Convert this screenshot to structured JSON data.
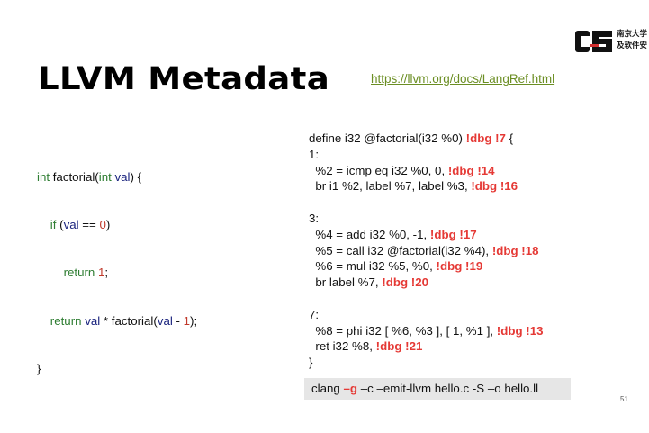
{
  "logo": {
    "mark": "CS",
    "line1": "南京大学",
    "line2": "及软件安",
    "colors": {
      "mark": "#111111",
      "accent": "#d32f2f"
    }
  },
  "slide": {
    "title": "LLVM Metadata",
    "ref_link": "https://llvm.org/docs/LangRef.html",
    "page_number": "51"
  },
  "c_code": {
    "line1": {
      "kw": "int",
      "fn": " factorial(",
      "kw2": "int",
      "var": " val",
      "rest": ") {"
    },
    "line2": {
      "indent": "    ",
      "kw": "if",
      "a": " (",
      "var": "val",
      "b": " == ",
      "num": "0",
      "c": ")"
    },
    "line3": {
      "indent": "        ",
      "kw": "return",
      "a": " ",
      "num": "1",
      "b": ";"
    },
    "line4": {
      "indent": "    ",
      "kw": "return",
      "var": " val",
      "a": " * factorial(",
      "var2": "val",
      "b": " - ",
      "num": "1",
      "c": ");"
    },
    "line5": {
      "text": "}"
    }
  },
  "ir": [
    {
      "text": "define i32 @factorial(i32 %0) ",
      "dbg": "!dbg !7",
      "tail": " {"
    },
    {
      "text": "1:",
      "dbg": "",
      "tail": ""
    },
    {
      "text": "  %2 = icmp eq i32 %0, 0, ",
      "dbg": "!dbg !14",
      "tail": ""
    },
    {
      "text": "  br i1 %2, label %7, label %3, ",
      "dbg": "!dbg !16",
      "tail": ""
    },
    {
      "text": "",
      "dbg": "",
      "tail": ""
    },
    {
      "text": "3:",
      "dbg": "",
      "tail": ""
    },
    {
      "text": "  %4 = add i32 %0, -1, ",
      "dbg": "!dbg !17",
      "tail": ""
    },
    {
      "text": "  %5 = call i32 @factorial(i32 %4), ",
      "dbg": "!dbg !18",
      "tail": ""
    },
    {
      "text": "  %6 = mul i32 %5, %0, ",
      "dbg": "!dbg !19",
      "tail": ""
    },
    {
      "text": "  br label %7, ",
      "dbg": "!dbg !20",
      "tail": ""
    },
    {
      "text": "",
      "dbg": "",
      "tail": ""
    },
    {
      "text": "7:",
      "dbg": "",
      "tail": ""
    },
    {
      "text": "  %8 = phi i32 [ %6, %3 ], [ 1, %1 ], ",
      "dbg": "!dbg !13",
      "tail": ""
    },
    {
      "text": "  ret i32 %8, ",
      "dbg": "!dbg !21",
      "tail": ""
    },
    {
      "text": "}",
      "dbg": "",
      "tail": ""
    }
  ],
  "command": {
    "pre": "clang ",
    "flag": "–g",
    "post": " –c –emit-llvm hello.c -S –o hello.ll"
  }
}
